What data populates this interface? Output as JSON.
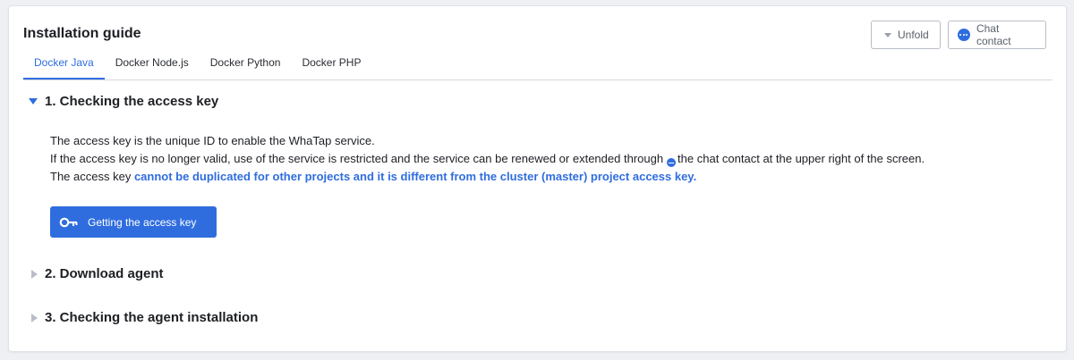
{
  "header": {
    "title": "Installation guide",
    "unfold_label": "Unfold",
    "chat_label": "Chat contact"
  },
  "tabs": [
    {
      "label": "Docker Java",
      "active": true
    },
    {
      "label": "Docker Node.js",
      "active": false
    },
    {
      "label": "Docker Python",
      "active": false
    },
    {
      "label": "Docker PHP",
      "active": false
    }
  ],
  "sections": [
    {
      "title": "1. Checking the access key",
      "expanded": true
    },
    {
      "title": "2. Download agent",
      "expanded": false
    },
    {
      "title": "3. Checking the agent installation",
      "expanded": false
    }
  ],
  "content": {
    "line1": "The access key is the unique ID to enable the WhaTap service.",
    "line2_before": "If the access key is no longer valid, use of the service is restricted and the service can be renewed or extended through",
    "line2_after": "the chat contact at the upper right of the screen.",
    "line3_before": "The access key ",
    "line3_emphasis": "cannot be duplicated for other projects and it is different from the cluster (master) project access key."
  },
  "access_key_button": "Getting the access key",
  "colors": {
    "accent": "#2f6ddf",
    "text": "#1d1f24",
    "border": "#b9bec6"
  }
}
